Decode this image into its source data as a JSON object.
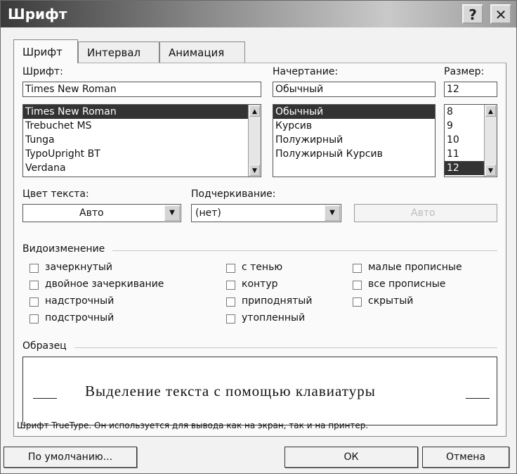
{
  "window": {
    "title": "Шрифт",
    "help_glyph": "?",
    "close_glyph": "✕"
  },
  "tabs": [
    {
      "label": "Шрифт",
      "active": true
    },
    {
      "label": "Интервал",
      "active": false
    },
    {
      "label": "Анимация",
      "active": false
    }
  ],
  "font": {
    "label": "Шрифт:",
    "value": "Times New Roman",
    "items": [
      "Times New Roman",
      "Trebuchet MS",
      "Tunga",
      "TypoUpright BT",
      "Verdana"
    ],
    "selected_index": 0
  },
  "style": {
    "label": "Начертание:",
    "value": "Обычный",
    "items": [
      "Обычный",
      "Курсив",
      "Полужирный",
      "Полужирный Курсив"
    ],
    "selected_index": 0
  },
  "size": {
    "label": "Размер:",
    "value": "12",
    "items": [
      "8",
      "9",
      "10",
      "11",
      "12"
    ],
    "selected_index": 4
  },
  "color": {
    "label": "Цвет текста:",
    "value": "Авто"
  },
  "underline": {
    "label": "Подчеркивание:",
    "value": "(нет)"
  },
  "underline_color": {
    "value": "Авто"
  },
  "effects": {
    "label": "Видоизменение",
    "items": [
      {
        "label": "зачеркнутый",
        "checked": false
      },
      {
        "label": "двойное зачеркивание",
        "checked": false
      },
      {
        "label": "надстрочный",
        "checked": false
      },
      {
        "label": "подстрочный",
        "checked": false
      },
      {
        "label": "с тенью",
        "checked": false
      },
      {
        "label": "контур",
        "checked": false
      },
      {
        "label": "приподнятый",
        "checked": false
      },
      {
        "label": "утопленный",
        "checked": false
      },
      {
        "label": "малые прописные",
        "checked": false
      },
      {
        "label": "все прописные",
        "checked": false
      },
      {
        "label": "скрытый",
        "checked": false
      }
    ]
  },
  "sample": {
    "label": "Образец",
    "text": "Выделение текста с помощью клавиатуры",
    "description": "Шрифт TrueType. Он используется для вывода как на экран, так и на принтер."
  },
  "buttons": {
    "default": "По умолчанию...",
    "ok": "ОК",
    "cancel": "Отмена"
  }
}
